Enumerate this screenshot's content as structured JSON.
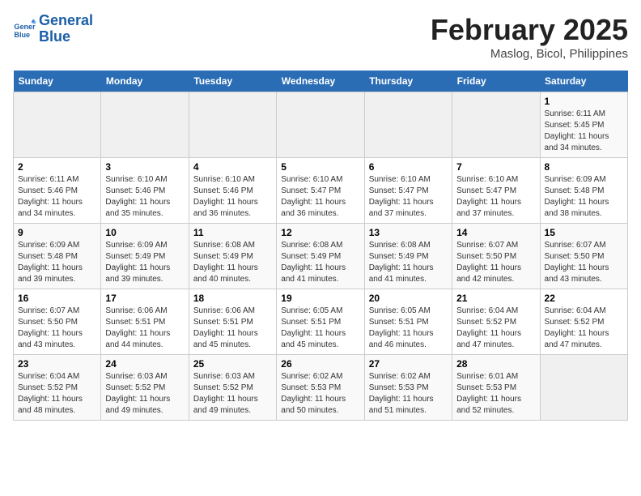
{
  "header": {
    "logo_line1": "General",
    "logo_line2": "Blue",
    "title": "February 2025",
    "subtitle": "Maslog, Bicol, Philippines"
  },
  "weekdays": [
    "Sunday",
    "Monday",
    "Tuesday",
    "Wednesday",
    "Thursday",
    "Friday",
    "Saturday"
  ],
  "weeks": [
    [
      {
        "day": "",
        "info": ""
      },
      {
        "day": "",
        "info": ""
      },
      {
        "day": "",
        "info": ""
      },
      {
        "day": "",
        "info": ""
      },
      {
        "day": "",
        "info": ""
      },
      {
        "day": "",
        "info": ""
      },
      {
        "day": "1",
        "info": "Sunrise: 6:11 AM\nSunset: 5:45 PM\nDaylight: 11 hours\nand 34 minutes."
      }
    ],
    [
      {
        "day": "2",
        "info": "Sunrise: 6:11 AM\nSunset: 5:46 PM\nDaylight: 11 hours\nand 34 minutes."
      },
      {
        "day": "3",
        "info": "Sunrise: 6:10 AM\nSunset: 5:46 PM\nDaylight: 11 hours\nand 35 minutes."
      },
      {
        "day": "4",
        "info": "Sunrise: 6:10 AM\nSunset: 5:46 PM\nDaylight: 11 hours\nand 36 minutes."
      },
      {
        "day": "5",
        "info": "Sunrise: 6:10 AM\nSunset: 5:47 PM\nDaylight: 11 hours\nand 36 minutes."
      },
      {
        "day": "6",
        "info": "Sunrise: 6:10 AM\nSunset: 5:47 PM\nDaylight: 11 hours\nand 37 minutes."
      },
      {
        "day": "7",
        "info": "Sunrise: 6:10 AM\nSunset: 5:47 PM\nDaylight: 11 hours\nand 37 minutes."
      },
      {
        "day": "8",
        "info": "Sunrise: 6:09 AM\nSunset: 5:48 PM\nDaylight: 11 hours\nand 38 minutes."
      }
    ],
    [
      {
        "day": "9",
        "info": "Sunrise: 6:09 AM\nSunset: 5:48 PM\nDaylight: 11 hours\nand 39 minutes."
      },
      {
        "day": "10",
        "info": "Sunrise: 6:09 AM\nSunset: 5:49 PM\nDaylight: 11 hours\nand 39 minutes."
      },
      {
        "day": "11",
        "info": "Sunrise: 6:08 AM\nSunset: 5:49 PM\nDaylight: 11 hours\nand 40 minutes."
      },
      {
        "day": "12",
        "info": "Sunrise: 6:08 AM\nSunset: 5:49 PM\nDaylight: 11 hours\nand 41 minutes."
      },
      {
        "day": "13",
        "info": "Sunrise: 6:08 AM\nSunset: 5:49 PM\nDaylight: 11 hours\nand 41 minutes."
      },
      {
        "day": "14",
        "info": "Sunrise: 6:07 AM\nSunset: 5:50 PM\nDaylight: 11 hours\nand 42 minutes."
      },
      {
        "day": "15",
        "info": "Sunrise: 6:07 AM\nSunset: 5:50 PM\nDaylight: 11 hours\nand 43 minutes."
      }
    ],
    [
      {
        "day": "16",
        "info": "Sunrise: 6:07 AM\nSunset: 5:50 PM\nDaylight: 11 hours\nand 43 minutes."
      },
      {
        "day": "17",
        "info": "Sunrise: 6:06 AM\nSunset: 5:51 PM\nDaylight: 11 hours\nand 44 minutes."
      },
      {
        "day": "18",
        "info": "Sunrise: 6:06 AM\nSunset: 5:51 PM\nDaylight: 11 hours\nand 45 minutes."
      },
      {
        "day": "19",
        "info": "Sunrise: 6:05 AM\nSunset: 5:51 PM\nDaylight: 11 hours\nand 45 minutes."
      },
      {
        "day": "20",
        "info": "Sunrise: 6:05 AM\nSunset: 5:51 PM\nDaylight: 11 hours\nand 46 minutes."
      },
      {
        "day": "21",
        "info": "Sunrise: 6:04 AM\nSunset: 5:52 PM\nDaylight: 11 hours\nand 47 minutes."
      },
      {
        "day": "22",
        "info": "Sunrise: 6:04 AM\nSunset: 5:52 PM\nDaylight: 11 hours\nand 47 minutes."
      }
    ],
    [
      {
        "day": "23",
        "info": "Sunrise: 6:04 AM\nSunset: 5:52 PM\nDaylight: 11 hours\nand 48 minutes."
      },
      {
        "day": "24",
        "info": "Sunrise: 6:03 AM\nSunset: 5:52 PM\nDaylight: 11 hours\nand 49 minutes."
      },
      {
        "day": "25",
        "info": "Sunrise: 6:03 AM\nSunset: 5:52 PM\nDaylight: 11 hours\nand 49 minutes."
      },
      {
        "day": "26",
        "info": "Sunrise: 6:02 AM\nSunset: 5:53 PM\nDaylight: 11 hours\nand 50 minutes."
      },
      {
        "day": "27",
        "info": "Sunrise: 6:02 AM\nSunset: 5:53 PM\nDaylight: 11 hours\nand 51 minutes."
      },
      {
        "day": "28",
        "info": "Sunrise: 6:01 AM\nSunset: 5:53 PM\nDaylight: 11 hours\nand 52 minutes."
      },
      {
        "day": "",
        "info": ""
      }
    ]
  ]
}
